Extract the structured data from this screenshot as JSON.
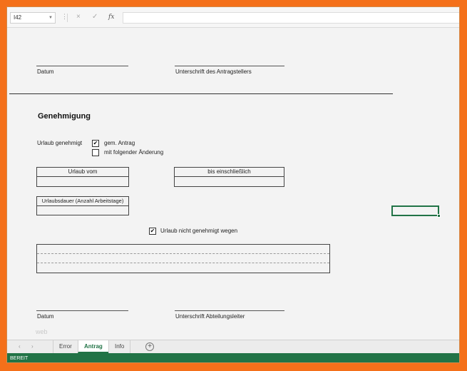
{
  "formula_bar": {
    "cell_reference": "I42",
    "cancel_icon": "×",
    "enter_icon": "✓",
    "fx_label": "fx",
    "formula_value": ""
  },
  "form": {
    "top_signature": {
      "date_label": "Datum",
      "signature_label": "Unterschrift des Antragstellers"
    },
    "section_title": "Genehmigung",
    "approval": {
      "label": "Urlaub genehmigt",
      "option1": {
        "label": "gem. Antrag",
        "checked": true
      },
      "option2": {
        "label": "mit folgender Änderung",
        "checked": false
      }
    },
    "vacation_from_label": "Urlaub vom",
    "vacation_until_label": "bis einschließlich",
    "duration_label": "Urlaubsdauer (Anzahl Arbeitstage)",
    "not_approved": {
      "label": "Urlaub nicht genehmigt wegen",
      "checked": true
    },
    "bottom_signature": {
      "date_label": "Datum",
      "signature_label": "Unterschrift Abteilungsleiter"
    },
    "watermark": "web"
  },
  "sheet_tabs": {
    "tabs": [
      {
        "label": "Error",
        "active": false
      },
      {
        "label": "Antrag",
        "active": true
      },
      {
        "label": "Info",
        "active": false
      }
    ],
    "add_icon": "⊕"
  },
  "status_bar": {
    "text": "BEREIT"
  },
  "colors": {
    "accent": "#217346",
    "frame": "#f4701a"
  }
}
